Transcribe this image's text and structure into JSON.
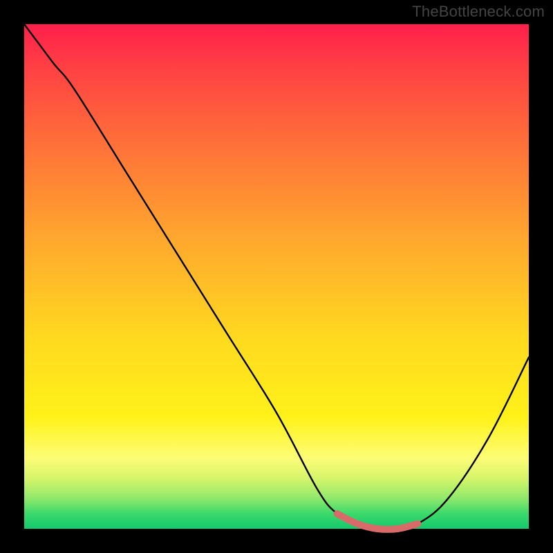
{
  "watermark": "TheBottleneck.com",
  "chart_data": {
    "type": "line",
    "title": "",
    "xlabel": "",
    "ylabel": "",
    "xlim": [
      0,
      100
    ],
    "ylim": [
      0,
      100
    ],
    "series": [
      {
        "name": "curve",
        "color": "#000000",
        "x": [
          0,
          3,
          6,
          10,
          20,
          30,
          40,
          50,
          58,
          62,
          66,
          70,
          74,
          78,
          84,
          92,
          100
        ],
        "y": [
          100,
          96,
          92,
          87,
          71,
          55,
          39,
          23,
          8,
          3,
          1,
          0,
          0,
          1,
          6,
          18,
          34
        ]
      },
      {
        "name": "highlight",
        "color": "#d86a6a",
        "x": [
          62,
          66,
          70,
          74,
          78
        ],
        "y": [
          3,
          1,
          0,
          0,
          1
        ]
      }
    ],
    "gradient_stops": [
      {
        "pos": 0.0,
        "color": "#ff1f4b"
      },
      {
        "pos": 0.08,
        "color": "#ff3e44"
      },
      {
        "pos": 0.22,
        "color": "#ff6b3a"
      },
      {
        "pos": 0.42,
        "color": "#ffa62e"
      },
      {
        "pos": 0.62,
        "color": "#ffd91f"
      },
      {
        "pos": 0.78,
        "color": "#fff21a"
      },
      {
        "pos": 0.86,
        "color": "#fdfd76"
      },
      {
        "pos": 0.9,
        "color": "#d6f56a"
      },
      {
        "pos": 0.94,
        "color": "#8fe86b"
      },
      {
        "pos": 0.97,
        "color": "#3bd96b"
      },
      {
        "pos": 1.0,
        "color": "#14c96c"
      }
    ]
  }
}
